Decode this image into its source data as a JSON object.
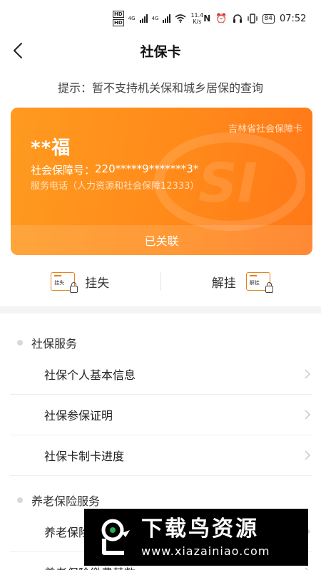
{
  "status_bar": {
    "net_a": "4G",
    "net_b": "4G",
    "speed_value": "11.4",
    "speed_unit": "K/s",
    "battery": "84",
    "time": "07:52"
  },
  "nav": {
    "title": "社保卡"
  },
  "hint": "提示：暂不支持机关保和城乡居保的查询",
  "card": {
    "issuer": "吉林省社会保障卡",
    "holder_name": "**福",
    "number_label": "社会保障号：",
    "number_value": "220*****9*******3*",
    "service_phone": "服务电话（人力资源和社会保障12333）",
    "status": "已关联",
    "gradient": [
      "#ff9a1f",
      "#ff7818"
    ]
  },
  "actions": {
    "report_loss": {
      "label": "挂失",
      "icon_text": "挂失"
    },
    "unfreeze": {
      "label": "解挂",
      "icon_text": "解挂"
    }
  },
  "sections": [
    {
      "title": "社保服务",
      "items": [
        "社保个人基本信息",
        "社保参保证明",
        "社保卡制卡进度"
      ]
    },
    {
      "title": "养老保险服务",
      "items": [
        "养老保险",
        "养老保险缴费基数"
      ]
    }
  ],
  "promo": {
    "title": "下载鸟资源",
    "url": "www.xiazainiao.com"
  },
  "colors": {
    "accent": "#ff8a1a",
    "divider": "#eeeeee"
  }
}
